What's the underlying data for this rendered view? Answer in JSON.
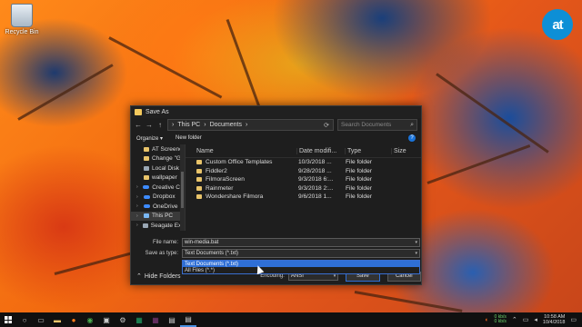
{
  "desktop": {
    "recycle_bin_label": "Recycle Bin",
    "brand_logo_text": "at"
  },
  "dialog": {
    "title": "Save As",
    "address": {
      "back": "←",
      "forward": "→",
      "up": "↑",
      "path": [
        "This PC",
        "Documents"
      ],
      "separator": "›"
    },
    "search_placeholder": "Search Documents",
    "toolbar": {
      "organize": "Organize ▾",
      "new_folder": "New folder"
    },
    "nav_items": [
      {
        "label": "AT Screenc",
        "icon": "folder-icon"
      },
      {
        "label": "Change \"Go",
        "icon": "folder-icon"
      },
      {
        "label": "Local Disk (",
        "icon": "drive-icon"
      },
      {
        "label": "wallpaper",
        "icon": "folder-icon"
      },
      {
        "label": "Creative Clo",
        "icon": "cloud-icon"
      },
      {
        "label": "Dropbox",
        "icon": "cloud-icon"
      },
      {
        "label": "OneDrive",
        "icon": "cloud-icon"
      },
      {
        "label": "This PC",
        "icon": "pc-icon",
        "selected": true
      },
      {
        "label": "Seagate Exp",
        "icon": "drive-icon"
      }
    ],
    "columns": {
      "name": "Name",
      "date": "Date modifi...",
      "type": "Type",
      "size": "Size"
    },
    "files": [
      {
        "name": "Custom Office Templates",
        "date": "10/3/2018 ...",
        "type": "File folder"
      },
      {
        "name": "Fiddler2",
        "date": "9/28/2018 ...",
        "type": "File folder"
      },
      {
        "name": "FilmoraScreen",
        "date": "9/3/2018 6:...",
        "type": "File folder"
      },
      {
        "name": "Rainmeter",
        "date": "9/3/2018 2:...",
        "type": "File folder"
      },
      {
        "name": "Wondershare Filmora",
        "date": "9/6/2018 1...",
        "type": "File folder"
      }
    ],
    "file_name_label": "File name:",
    "file_name_value": "win-media.bat",
    "save_as_type_label": "Save as type:",
    "save_as_type_value": "Text Documents (*.txt)",
    "save_as_type_options": [
      "Text Documents (*.txt)",
      "All Files  (*.*)"
    ],
    "hide_folders": "Hide Folders",
    "encoding_label": "Encoding:",
    "encoding_value": "ANSI",
    "save_button": "Save",
    "cancel_button": "Cancel"
  },
  "taskbar": {
    "net_up": "0 kb/s",
    "net_down": "0 kb/s",
    "time": "10:58 AM",
    "date": "10/4/2018"
  }
}
